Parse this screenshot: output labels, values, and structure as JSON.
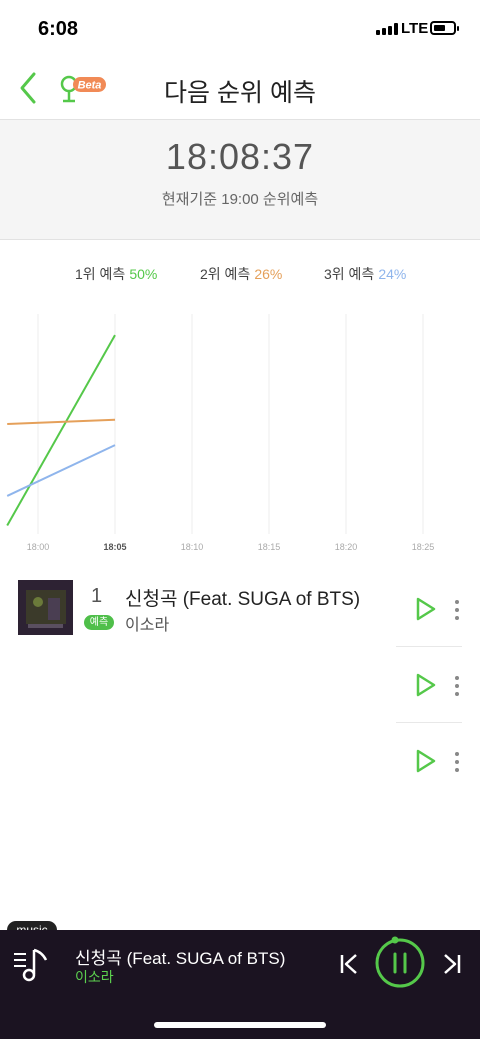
{
  "status": {
    "time": "6:08",
    "network": "LTE"
  },
  "header": {
    "title": "다음 순위 예측",
    "beta_label": "Beta"
  },
  "timer": {
    "clock": "18:08:37",
    "subtitle": "현재기준 19:00 순위예측"
  },
  "legend": [
    {
      "label": "1위 예측",
      "pct": "50%",
      "color": "#55c84a"
    },
    {
      "label": "2위 예측",
      "pct": "26%",
      "color": "#e5a05a"
    },
    {
      "label": "3위 예측",
      "pct": "24%",
      "color": "#8fb5ec"
    }
  ],
  "chart_data": {
    "type": "line",
    "x_ticks": [
      "18:00",
      "18:05",
      "18:10",
      "18:15",
      "18:20",
      "18:25"
    ],
    "x": [
      "17:58",
      "18:05"
    ],
    "series": [
      {
        "values": [
          5,
          50
        ],
        "color": "#55c84a"
      },
      {
        "values": [
          29,
          30
        ],
        "color": "#e5a05a"
      },
      {
        "values": [
          12,
          24
        ],
        "color": "#8fb5ec"
      }
    ],
    "ylim": [
      3,
      55
    ],
    "grid": true,
    "legend": "top"
  },
  "ranking": [
    {
      "rank": "1",
      "badge": "예측",
      "song": "신청곡 (Feat. SUGA of BTS)",
      "artist": "이소라"
    }
  ],
  "player": {
    "tab_label": "music",
    "song": "신청곡 (Feat. SUGA of BTS)",
    "artist": "이소라"
  },
  "colors": {
    "accent": "#55c84a",
    "player_bg": "#1b1321"
  }
}
